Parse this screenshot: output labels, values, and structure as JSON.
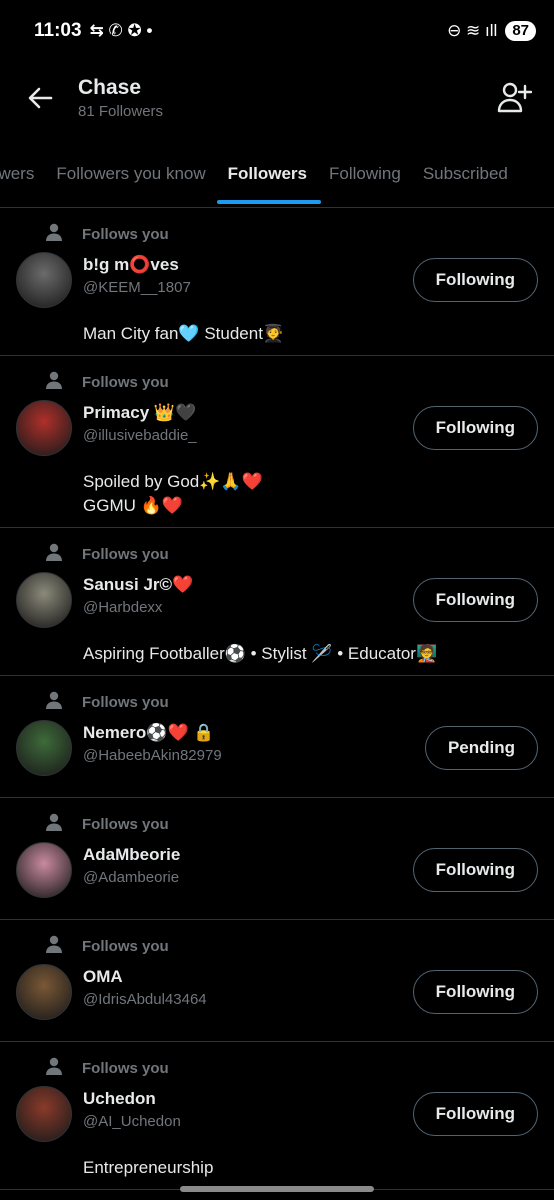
{
  "status_bar": {
    "time": "11:03",
    "icons_left": "⇆ ✆ ✪ •",
    "icons_right": "⊖ ≋ ıll",
    "battery": "87"
  },
  "header": {
    "title": "Chase",
    "subtitle": "81 Followers"
  },
  "tabs": [
    {
      "label": "owers"
    },
    {
      "label": "Followers you know"
    },
    {
      "label": "Followers"
    },
    {
      "label": "Following"
    },
    {
      "label": "Subscribed"
    }
  ],
  "follows_you_label": "Follows you",
  "users": [
    {
      "name": "b!g m⭕ves",
      "handle": "@KEEM__1807",
      "bio": "Man City fan🩵   Student🧑‍🎓",
      "button": "Following",
      "avatar_color": "#6b6b6b"
    },
    {
      "name": "Primacy 👑🖤",
      "handle": "@illusivebaddie_",
      "bio": "Spoiled by God✨🙏❤️\nGGMU 🔥❤️",
      "button": "Following",
      "avatar_color": "#b0302a"
    },
    {
      "name": "Sanusi Jr©❤️",
      "handle": "@Harbdexx",
      "bio": "Aspiring Footballer⚽ • Stylist 🪡 • Educator🧑‍🏫",
      "button": "Following",
      "avatar_color": "#8c8a7a"
    },
    {
      "name": "Nemero⚽❤️ 🔒",
      "handle": "@HabeebAkin82979",
      "bio": "",
      "button": "Pending",
      "avatar_color": "#3e6b3a"
    },
    {
      "name": "AdaMbeorie",
      "handle": "@Adambeorie",
      "bio": "",
      "button": "Following",
      "avatar_color": "#c98aa0"
    },
    {
      "name": "OMA",
      "handle": "@IdrisAbdul43464",
      "bio": "",
      "button": "Following",
      "avatar_color": "#7a5836"
    },
    {
      "name": "Uchedon",
      "handle": "@AI_Uchedon",
      "bio": "Entrepreneurship",
      "button": "Following",
      "avatar_color": "#8a3a2a"
    }
  ],
  "colors": {
    "background": "#000000",
    "accent": "#1d9bf0",
    "secondary_text": "#71767b",
    "divider": "#2f3336"
  }
}
